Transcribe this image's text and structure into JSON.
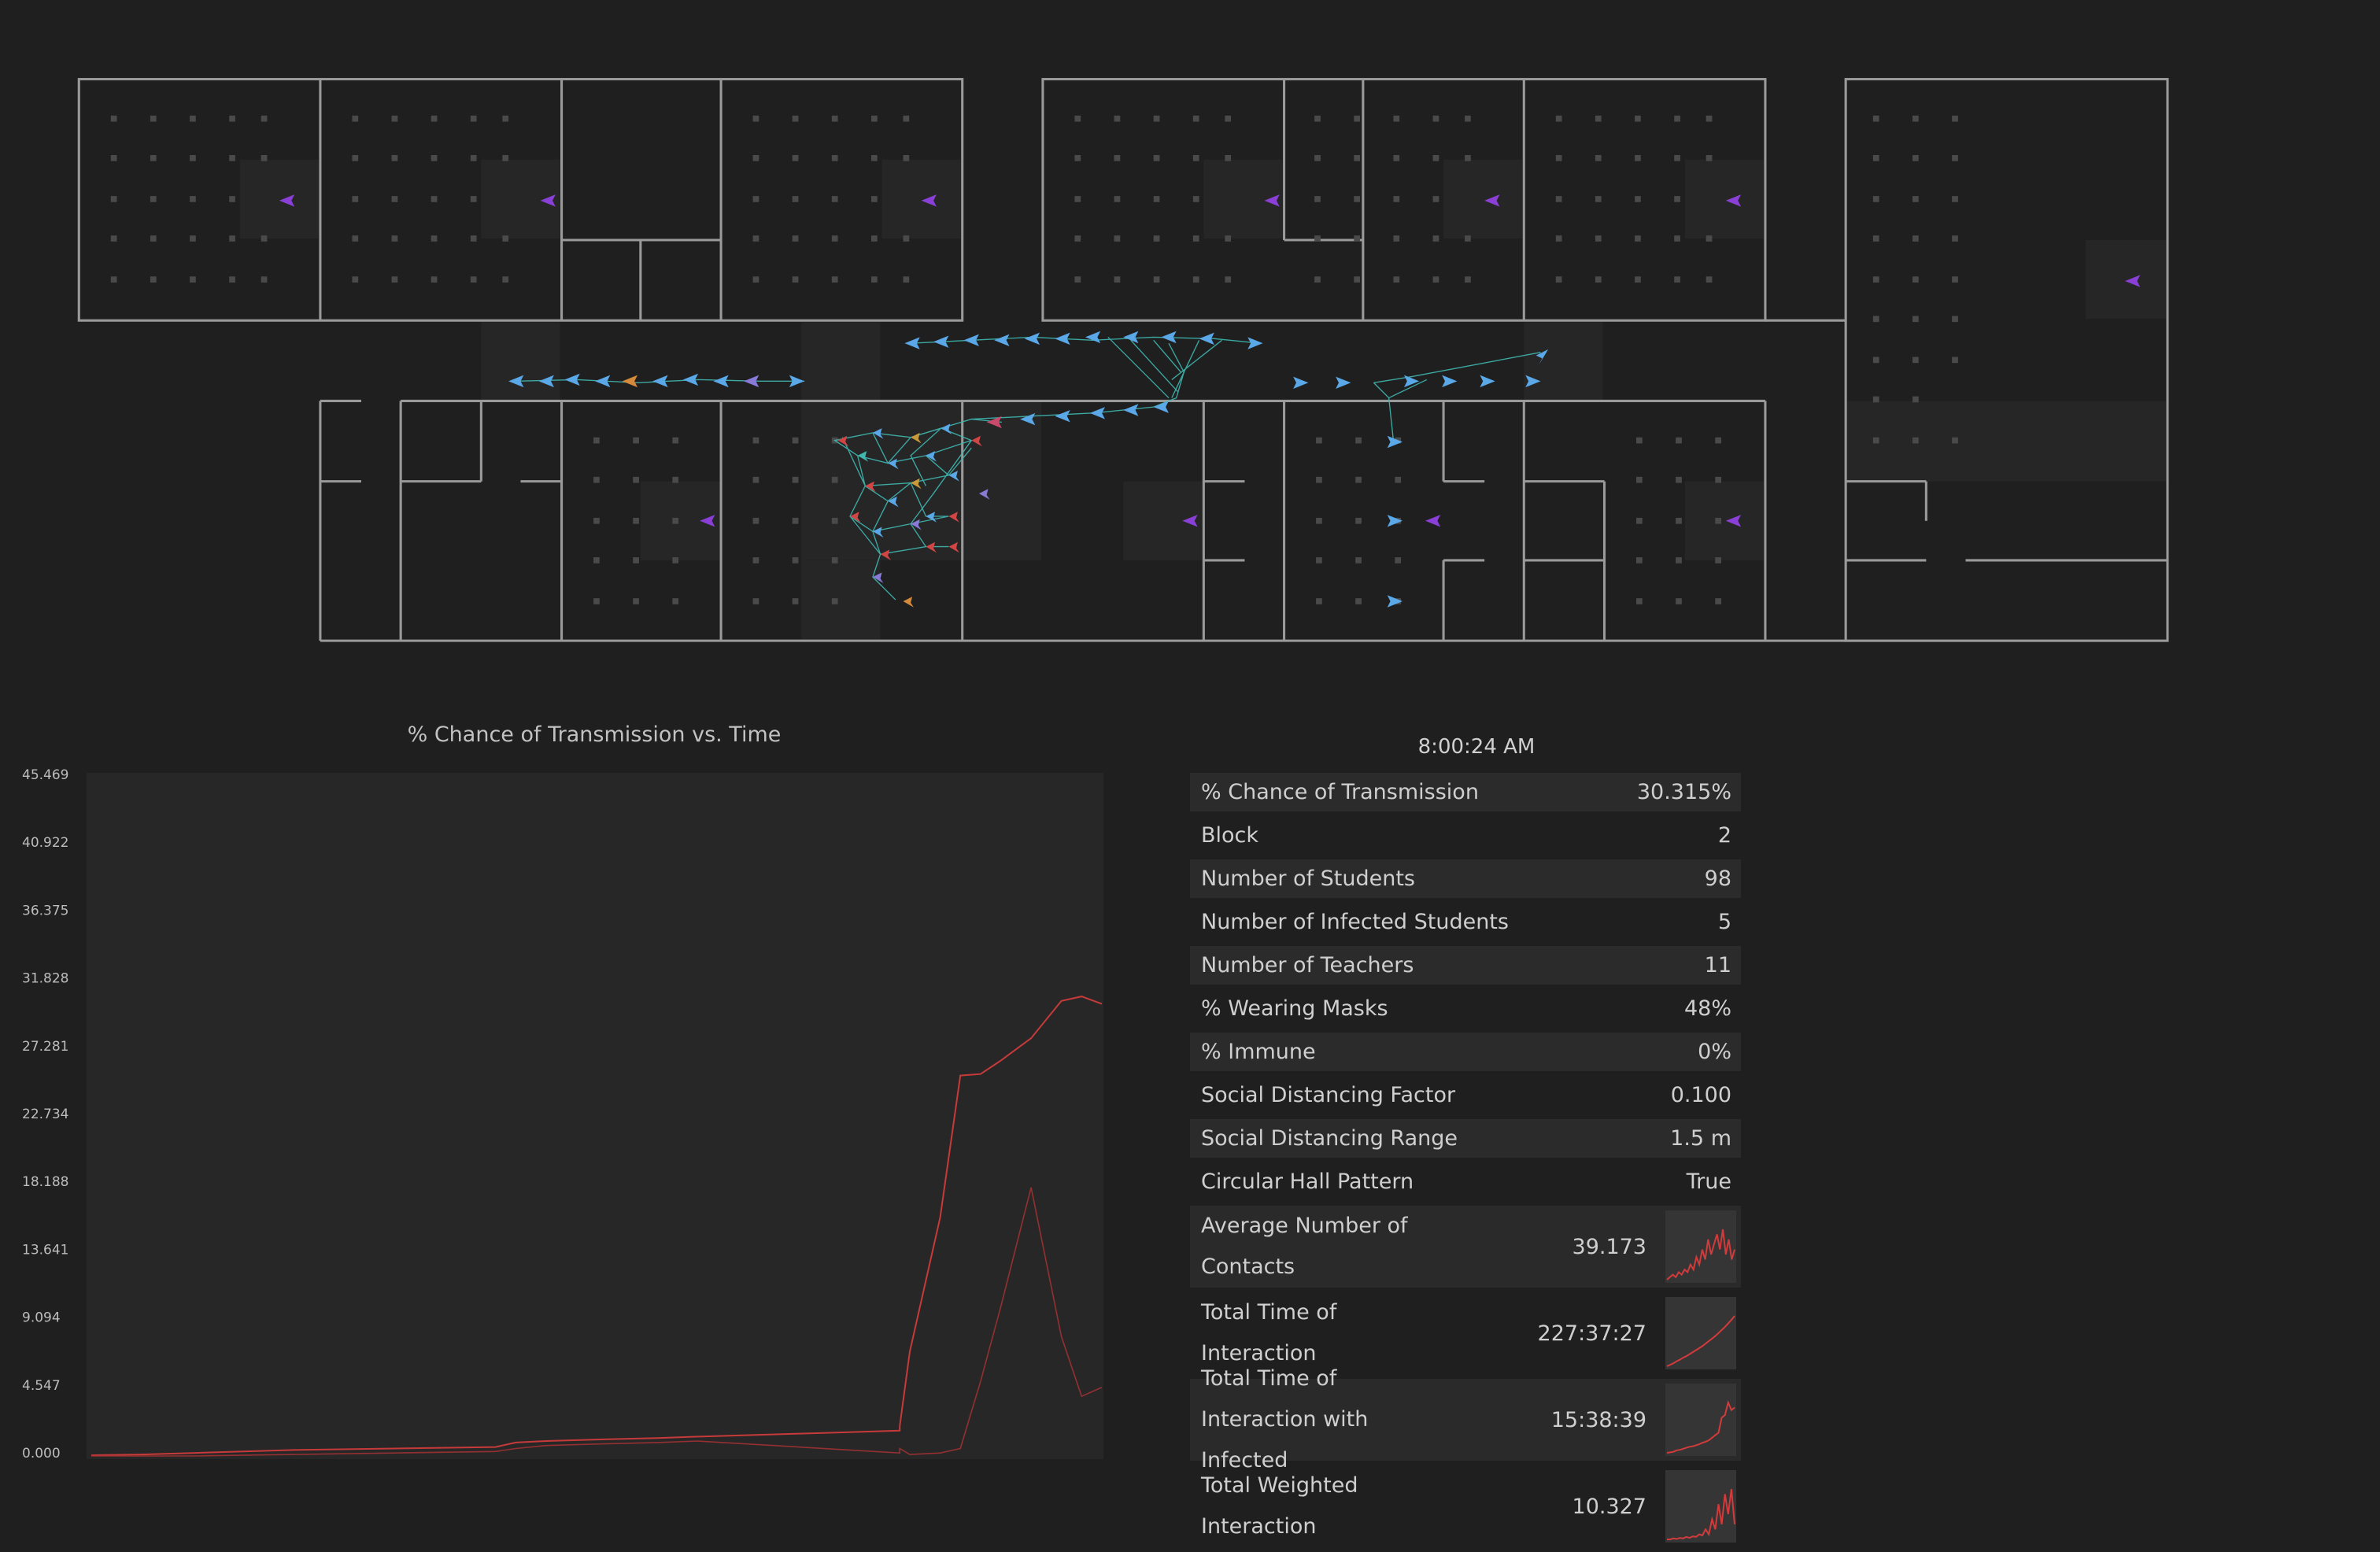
{
  "chart_data": {
    "type": "line",
    "title": "% Chance of Transmission vs. Time",
    "xlabel": "",
    "ylabel": "",
    "ylim": [
      0,
      45.469
    ],
    "y_ticks": [
      "45.469",
      "40.922",
      "36.375",
      "31.828",
      "27.281",
      "22.734",
      "18.188",
      "13.641",
      "9.094",
      "4.547",
      "0.000"
    ],
    "x": [
      0,
      0.05,
      0.1,
      0.2,
      0.3,
      0.4,
      0.42,
      0.45,
      0.5,
      0.56,
      0.6,
      0.7,
      0.75,
      0.8,
      0.8,
      0.81,
      0.84,
      0.86,
      0.88,
      0.9,
      0.93,
      0.96,
      0.98,
      1.0
    ],
    "series": [
      {
        "values": [
          0.05,
          0.1,
          0.2,
          0.4,
          0.5,
          0.6,
          0.9,
          1.0,
          1.1,
          1.2,
          1.3,
          1.5,
          1.6,
          1.7,
          2.0,
          7.0,
          16.0,
          25.5,
          25.6,
          26.5,
          28.0,
          30.5,
          30.8,
          30.3
        ]
      },
      {
        "values": [
          0.0,
          0.0,
          0.0,
          0.1,
          0.2,
          0.3,
          0.5,
          0.7,
          0.8,
          0.9,
          1.0,
          0.6,
          0.4,
          0.2,
          0.5,
          0.1,
          0.2,
          0.5,
          5.0,
          10.0,
          18.0,
          8.0,
          4.0,
          4.6
        ]
      }
    ],
    "grid": false,
    "colors": {
      "series": "#c73a3a",
      "panel": "#272728"
    }
  },
  "clock": "8:00:24 AM",
  "stats": [
    {
      "label": "% Chance of Transmission",
      "value": "30.315%"
    },
    {
      "label": "Block",
      "value": "2"
    },
    {
      "label": "Number of Students",
      "value": "98"
    },
    {
      "label": "Number of Infected Students",
      "value": "5"
    },
    {
      "label": "Number of Teachers",
      "value": "11"
    },
    {
      "label": "% Wearing Masks",
      "value": "48%"
    },
    {
      "label": "% Immune",
      "value": "0%"
    },
    {
      "label": "Social Distancing Factor",
      "value": "0.100"
    },
    {
      "label": "Social Distancing Range",
      "value": "1.5 m"
    },
    {
      "label": "Circular Hall Pattern",
      "value": "True"
    }
  ],
  "spark_stats": [
    {
      "label": "Average Number of Contacts",
      "value": "39.173",
      "spark": [
        0,
        0.05,
        0.1,
        0.05,
        0.15,
        0.1,
        0.2,
        0.15,
        0.3,
        0.2,
        0.45,
        0.3,
        0.6,
        0.4,
        0.8,
        0.5,
        0.7,
        0.9,
        0.6,
        1.0,
        0.5,
        0.8,
        0.4,
        0.6
      ]
    },
    {
      "label": "Total Time of Interaction",
      "value": "227:37:27",
      "spark": [
        0,
        0.03,
        0.06,
        0.1,
        0.13,
        0.17,
        0.2,
        0.24,
        0.28,
        0.32,
        0.36,
        0.4,
        0.45,
        0.5,
        0.55,
        0.6,
        0.66,
        0.72,
        0.78,
        0.85,
        0.92,
        1.0
      ]
    },
    {
      "label": "Total Time of Interaction with Infected",
      "value": "15:38:39",
      "spark": [
        0,
        0.01,
        0.02,
        0.05,
        0.06,
        0.08,
        0.1,
        0.12,
        0.13,
        0.15,
        0.17,
        0.2,
        0.22,
        0.25,
        0.3,
        0.35,
        0.4,
        0.7,
        0.75,
        1.0,
        0.85,
        0.9
      ]
    },
    {
      "label": "Total Weighted Interaction",
      "value": "10.327",
      "spark": [
        0,
        0,
        0.02,
        0.01,
        0.03,
        0.02,
        0.05,
        0.03,
        0.06,
        0.05,
        0.1,
        0.08,
        0.2,
        0.1,
        0.4,
        0.2,
        0.7,
        0.3,
        0.9,
        0.5,
        1.0,
        0.3
      ]
    }
  ]
}
